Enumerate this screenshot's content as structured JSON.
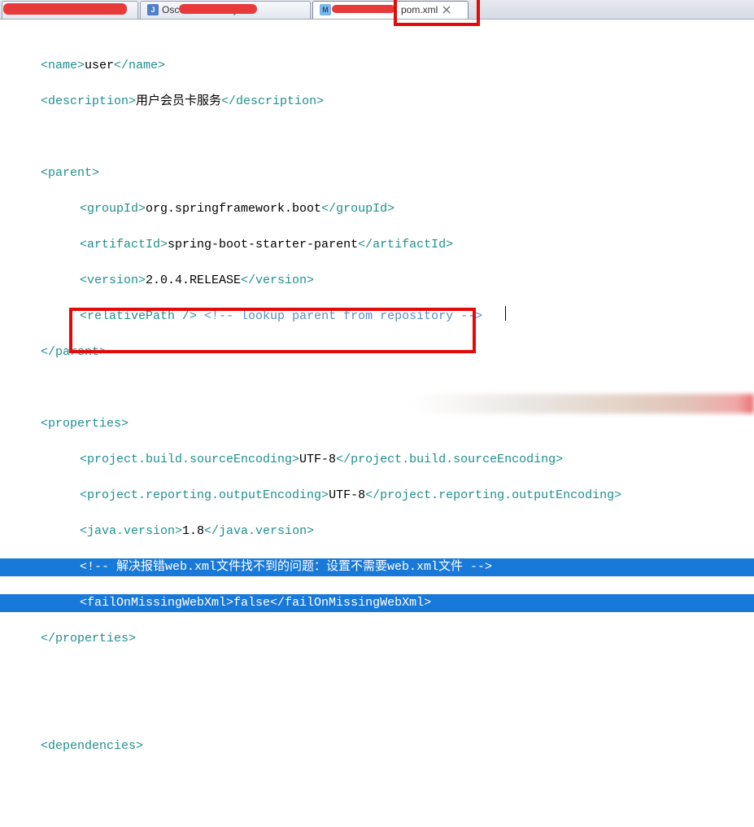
{
  "tabs": {
    "t1": {
      "label": ""
    },
    "t2": {
      "icon": "J",
      "label_prefix": "Osc",
      "label_suffix": ".java"
    },
    "t3": {
      "icon": "M",
      "label_suffix": "pom.xml"
    }
  },
  "annotations": {
    "red_box_tab_title": "pom.xml highlight",
    "red_box_code_title": "failOnMissingWebXml highlight"
  },
  "xml": {
    "name_open": "<name>",
    "name_text": "user",
    "name_close": "</name>",
    "desc_open": "<description>",
    "desc_text": "用户会员卡服务",
    "desc_close": "</description>",
    "parent_open": "<parent>",
    "groupId_open": "<groupId>",
    "groupId_text": "org.springframework.boot",
    "groupId_close": "</groupId>",
    "artifactId_open": "<artifactId>",
    "artifactId_text": "spring-boot-starter-parent",
    "artifactId_close": "</artifactId>",
    "version_open": "<version>",
    "version_text": "2.0.4.RELEASE",
    "version_close": "</version>",
    "relpath": "<relativePath />",
    "relpath_comment": "<!-- lookup parent from repository -->",
    "parent_close": "</parent>",
    "prop_open": "<properties>",
    "enc_open": "<project.build.sourceEncoding>",
    "enc_text": "UTF-8",
    "enc_close": "</project.build.sourceEncoding>",
    "renc_open": "<project.reporting.outputEncoding>",
    "renc_text": "UTF-8",
    "renc_close": "</project.reporting.outputEncoding>",
    "jv_open": "<java.version>",
    "jv_text": "1.8",
    "jv_close": "</java.version>",
    "sel_comment": "<!-- 解决报错web.xml文件找不到的问题：设置不需要web.xml文件 -->",
    "fail_open": "<failOnMissingWebXml>",
    "fail_text": "false",
    "fail_close": "</failOnMissingWebXml>",
    "prop_close": "</properties>",
    "dep_open": "<dependencies>"
  }
}
